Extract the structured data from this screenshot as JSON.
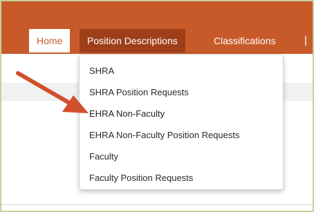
{
  "nav": {
    "tabs": [
      {
        "label": "Home"
      },
      {
        "label": "Position Descriptions"
      },
      {
        "label": "Classifications"
      }
    ],
    "separator": "|"
  },
  "dropdown": {
    "items": [
      {
        "label": "SHRA"
      },
      {
        "label": "SHRA Position Requests"
      },
      {
        "label": "EHRA Non-Faculty"
      },
      {
        "label": "EHRA Non-Faculty Position Requests"
      },
      {
        "label": "Faculty"
      },
      {
        "label": "Faculty Position Requests"
      }
    ]
  },
  "colors": {
    "brand": "#c85a2a",
    "active_tab": "#9e3f1a",
    "arrow": "#d2502b"
  },
  "icons": {
    "annotation": "red-pointer-arrow-icon"
  }
}
